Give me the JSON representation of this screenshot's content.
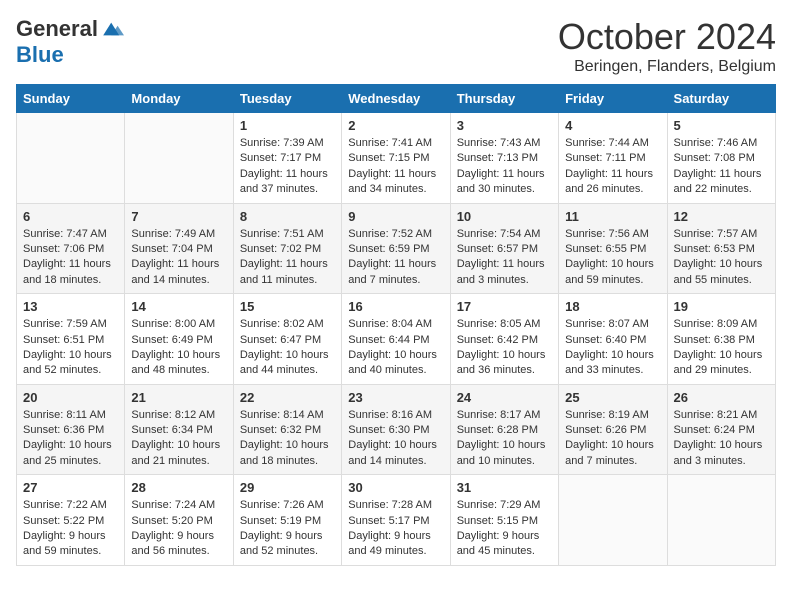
{
  "logo": {
    "general": "General",
    "blue": "Blue"
  },
  "header": {
    "month": "October 2024",
    "location": "Beringen, Flanders, Belgium"
  },
  "weekdays": [
    "Sunday",
    "Monday",
    "Tuesday",
    "Wednesday",
    "Thursday",
    "Friday",
    "Saturday"
  ],
  "weeks": [
    [
      {
        "day": "",
        "sunrise": "",
        "sunset": "",
        "daylight": ""
      },
      {
        "day": "",
        "sunrise": "",
        "sunset": "",
        "daylight": ""
      },
      {
        "day": "1",
        "sunrise": "Sunrise: 7:39 AM",
        "sunset": "Sunset: 7:17 PM",
        "daylight": "Daylight: 11 hours and 37 minutes."
      },
      {
        "day": "2",
        "sunrise": "Sunrise: 7:41 AM",
        "sunset": "Sunset: 7:15 PM",
        "daylight": "Daylight: 11 hours and 34 minutes."
      },
      {
        "day": "3",
        "sunrise": "Sunrise: 7:43 AM",
        "sunset": "Sunset: 7:13 PM",
        "daylight": "Daylight: 11 hours and 30 minutes."
      },
      {
        "day": "4",
        "sunrise": "Sunrise: 7:44 AM",
        "sunset": "Sunset: 7:11 PM",
        "daylight": "Daylight: 11 hours and 26 minutes."
      },
      {
        "day": "5",
        "sunrise": "Sunrise: 7:46 AM",
        "sunset": "Sunset: 7:08 PM",
        "daylight": "Daylight: 11 hours and 22 minutes."
      }
    ],
    [
      {
        "day": "6",
        "sunrise": "Sunrise: 7:47 AM",
        "sunset": "Sunset: 7:06 PM",
        "daylight": "Daylight: 11 hours and 18 minutes."
      },
      {
        "day": "7",
        "sunrise": "Sunrise: 7:49 AM",
        "sunset": "Sunset: 7:04 PM",
        "daylight": "Daylight: 11 hours and 14 minutes."
      },
      {
        "day": "8",
        "sunrise": "Sunrise: 7:51 AM",
        "sunset": "Sunset: 7:02 PM",
        "daylight": "Daylight: 11 hours and 11 minutes."
      },
      {
        "day": "9",
        "sunrise": "Sunrise: 7:52 AM",
        "sunset": "Sunset: 6:59 PM",
        "daylight": "Daylight: 11 hours and 7 minutes."
      },
      {
        "day": "10",
        "sunrise": "Sunrise: 7:54 AM",
        "sunset": "Sunset: 6:57 PM",
        "daylight": "Daylight: 11 hours and 3 minutes."
      },
      {
        "day": "11",
        "sunrise": "Sunrise: 7:56 AM",
        "sunset": "Sunset: 6:55 PM",
        "daylight": "Daylight: 10 hours and 59 minutes."
      },
      {
        "day": "12",
        "sunrise": "Sunrise: 7:57 AM",
        "sunset": "Sunset: 6:53 PM",
        "daylight": "Daylight: 10 hours and 55 minutes."
      }
    ],
    [
      {
        "day": "13",
        "sunrise": "Sunrise: 7:59 AM",
        "sunset": "Sunset: 6:51 PM",
        "daylight": "Daylight: 10 hours and 52 minutes."
      },
      {
        "day": "14",
        "sunrise": "Sunrise: 8:00 AM",
        "sunset": "Sunset: 6:49 PM",
        "daylight": "Daylight: 10 hours and 48 minutes."
      },
      {
        "day": "15",
        "sunrise": "Sunrise: 8:02 AM",
        "sunset": "Sunset: 6:47 PM",
        "daylight": "Daylight: 10 hours and 44 minutes."
      },
      {
        "day": "16",
        "sunrise": "Sunrise: 8:04 AM",
        "sunset": "Sunset: 6:44 PM",
        "daylight": "Daylight: 10 hours and 40 minutes."
      },
      {
        "day": "17",
        "sunrise": "Sunrise: 8:05 AM",
        "sunset": "Sunset: 6:42 PM",
        "daylight": "Daylight: 10 hours and 36 minutes."
      },
      {
        "day": "18",
        "sunrise": "Sunrise: 8:07 AM",
        "sunset": "Sunset: 6:40 PM",
        "daylight": "Daylight: 10 hours and 33 minutes."
      },
      {
        "day": "19",
        "sunrise": "Sunrise: 8:09 AM",
        "sunset": "Sunset: 6:38 PM",
        "daylight": "Daylight: 10 hours and 29 minutes."
      }
    ],
    [
      {
        "day": "20",
        "sunrise": "Sunrise: 8:11 AM",
        "sunset": "Sunset: 6:36 PM",
        "daylight": "Daylight: 10 hours and 25 minutes."
      },
      {
        "day": "21",
        "sunrise": "Sunrise: 8:12 AM",
        "sunset": "Sunset: 6:34 PM",
        "daylight": "Daylight: 10 hours and 21 minutes."
      },
      {
        "day": "22",
        "sunrise": "Sunrise: 8:14 AM",
        "sunset": "Sunset: 6:32 PM",
        "daylight": "Daylight: 10 hours and 18 minutes."
      },
      {
        "day": "23",
        "sunrise": "Sunrise: 8:16 AM",
        "sunset": "Sunset: 6:30 PM",
        "daylight": "Daylight: 10 hours and 14 minutes."
      },
      {
        "day": "24",
        "sunrise": "Sunrise: 8:17 AM",
        "sunset": "Sunset: 6:28 PM",
        "daylight": "Daylight: 10 hours and 10 minutes."
      },
      {
        "day": "25",
        "sunrise": "Sunrise: 8:19 AM",
        "sunset": "Sunset: 6:26 PM",
        "daylight": "Daylight: 10 hours and 7 minutes."
      },
      {
        "day": "26",
        "sunrise": "Sunrise: 8:21 AM",
        "sunset": "Sunset: 6:24 PM",
        "daylight": "Daylight: 10 hours and 3 minutes."
      }
    ],
    [
      {
        "day": "27",
        "sunrise": "Sunrise: 7:22 AM",
        "sunset": "Sunset: 5:22 PM",
        "daylight": "Daylight: 9 hours and 59 minutes."
      },
      {
        "day": "28",
        "sunrise": "Sunrise: 7:24 AM",
        "sunset": "Sunset: 5:20 PM",
        "daylight": "Daylight: 9 hours and 56 minutes."
      },
      {
        "day": "29",
        "sunrise": "Sunrise: 7:26 AM",
        "sunset": "Sunset: 5:19 PM",
        "daylight": "Daylight: 9 hours and 52 minutes."
      },
      {
        "day": "30",
        "sunrise": "Sunrise: 7:28 AM",
        "sunset": "Sunset: 5:17 PM",
        "daylight": "Daylight: 9 hours and 49 minutes."
      },
      {
        "day": "31",
        "sunrise": "Sunrise: 7:29 AM",
        "sunset": "Sunset: 5:15 PM",
        "daylight": "Daylight: 9 hours and 45 minutes."
      },
      {
        "day": "",
        "sunrise": "",
        "sunset": "",
        "daylight": ""
      },
      {
        "day": "",
        "sunrise": "",
        "sunset": "",
        "daylight": ""
      }
    ]
  ]
}
